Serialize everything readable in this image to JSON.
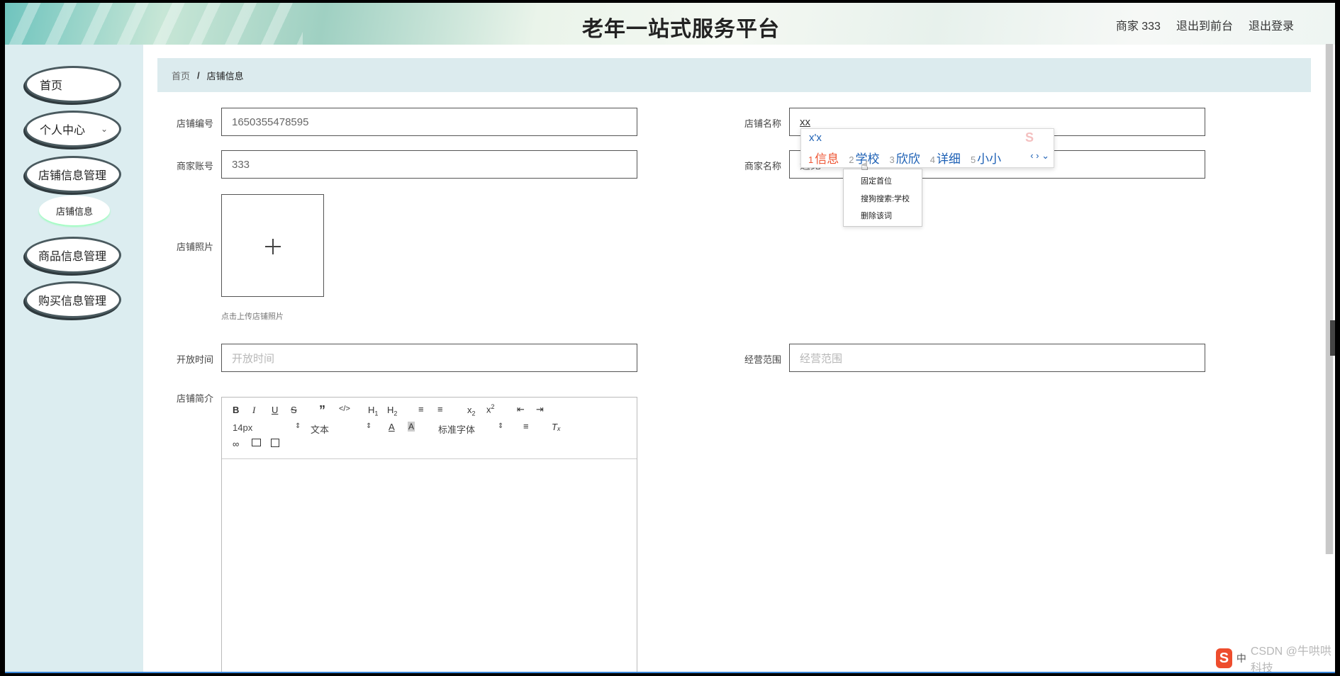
{
  "header": {
    "title": "老年一站式服务平台",
    "user": "商家 333",
    "to_front": "退出到前台",
    "logout": "退出登录"
  },
  "sidebar": {
    "items": [
      {
        "label": "首页"
      },
      {
        "label": "个人中心"
      },
      {
        "label": "店铺信息管理"
      },
      {
        "label": "店铺信息"
      },
      {
        "label": "商品信息管理"
      },
      {
        "label": "购买信息管理"
      }
    ]
  },
  "breadcrumb": {
    "home": "首页",
    "sep": "/",
    "current": "店铺信息"
  },
  "form": {
    "shop_no_label": "店铺编号",
    "shop_no_value": "1650355478595",
    "shop_name_label": "店铺名称",
    "shop_name_value": "xx",
    "merchant_account_label": "商家账号",
    "merchant_account_value": "333",
    "merchant_name_label": "商家名称",
    "merchant_name_value": "遇见",
    "photo_label": "店铺照片",
    "photo_hint": "点击上传店铺照片",
    "open_time_label": "开放时间",
    "open_time_placeholder": "开放时间",
    "scope_label": "经营范围",
    "scope_placeholder": "经营范围",
    "intro_label": "店铺简介"
  },
  "editor_toolbar": {
    "font_size": "14px",
    "text_style": "文本",
    "font_family": "标准字体"
  },
  "ime": {
    "pinyin": "x'x",
    "candidates": [
      {
        "n": "1",
        "text": "信息"
      },
      {
        "n": "2",
        "text": "学校"
      },
      {
        "n": "3",
        "text": "欣欣"
      },
      {
        "n": "4",
        "text": "详细"
      },
      {
        "n": "5",
        "text": "小小"
      }
    ],
    "menu": [
      "固定首位",
      "搜狗搜索:学校",
      "删除该词"
    ]
  },
  "tray": {
    "input_mode": "中",
    "watermark": "CSDN @牛哄哄科技"
  }
}
